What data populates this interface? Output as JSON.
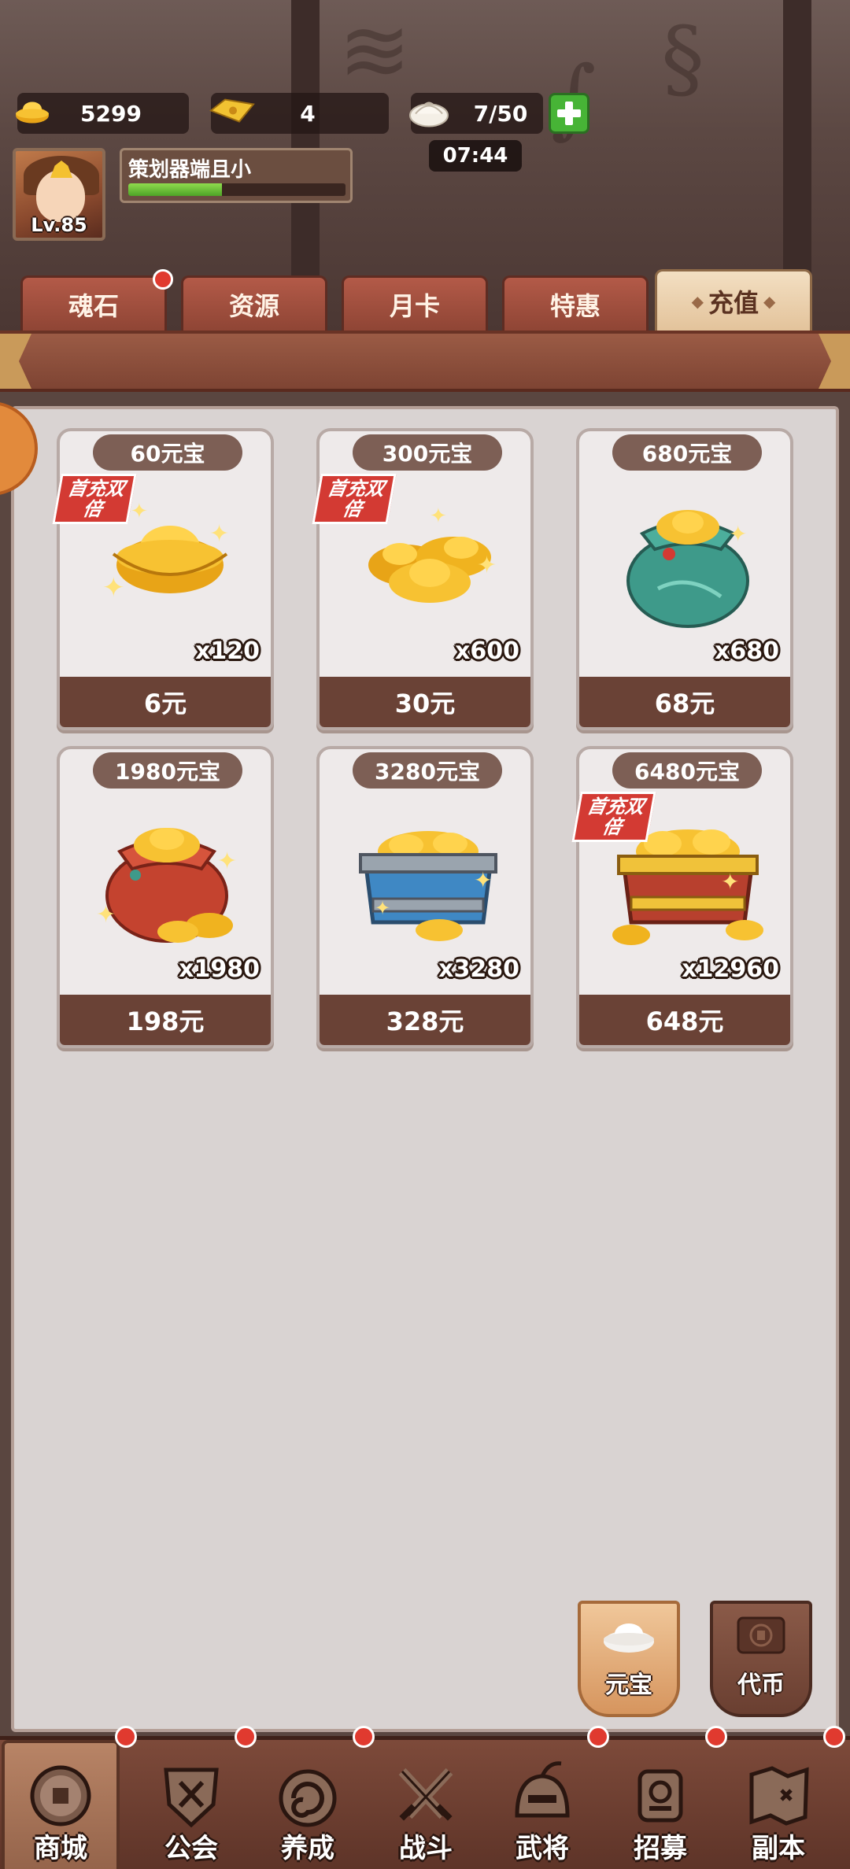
{
  "resources": {
    "gold": "5299",
    "tickets": "4",
    "stamina": "7/50",
    "timer": "07:44"
  },
  "player": {
    "name": "策划器端且小",
    "level": "Lv.85",
    "xp_fraction": 0.43
  },
  "tabs": [
    {
      "label": "魂石",
      "has_dot": true
    },
    {
      "label": "资源",
      "has_dot": false
    },
    {
      "label": "月卡",
      "has_dot": false
    },
    {
      "label": "特惠",
      "has_dot": false
    },
    {
      "label": "充值",
      "has_dot": false,
      "active": true
    }
  ],
  "badge_text": "首充双倍",
  "products": [
    {
      "label": "60元宝",
      "qty": "x120",
      "price": "6元",
      "first_double": true,
      "art": "gold-ingot"
    },
    {
      "label": "300元宝",
      "qty": "x600",
      "price": "30元",
      "first_double": true,
      "art": "gold-pile"
    },
    {
      "label": "680元宝",
      "qty": "x680",
      "price": "68元",
      "first_double": false,
      "art": "green-bag"
    },
    {
      "label": "1980元宝",
      "qty": "x1980",
      "price": "198元",
      "first_double": false,
      "art": "red-bag"
    },
    {
      "label": "3280元宝",
      "qty": "x3280",
      "price": "328元",
      "first_double": false,
      "art": "blue-chest"
    },
    {
      "label": "6480元宝",
      "qty": "x12960",
      "price": "648元",
      "first_double": true,
      "art": "gold-chest"
    }
  ],
  "currency_toggle": {
    "yuanbao": "元宝",
    "daibi": "代币"
  },
  "bottom_nav": [
    {
      "label": "商城",
      "icon": "coin-icon",
      "active": true,
      "dot": true
    },
    {
      "label": "公会",
      "icon": "guild-shield-icon",
      "active": false,
      "dot": true
    },
    {
      "label": "养成",
      "icon": "swirl-icon",
      "active": false,
      "dot": true
    },
    {
      "label": "战斗",
      "icon": "crossed-swords-icon",
      "active": false,
      "dot": false
    },
    {
      "label": "武将",
      "icon": "helmet-icon",
      "active": false,
      "dot": true
    },
    {
      "label": "招募",
      "icon": "scroll-token-icon",
      "active": false,
      "dot": true
    },
    {
      "label": "副本",
      "icon": "map-icon",
      "active": false,
      "dot": true
    }
  ],
  "colors": {
    "tab_red": "#a04d3d",
    "tab_active": "#ecd2b0",
    "price_bar": "#6a4236",
    "badge_red": "#d33a33",
    "notify_red": "#e03a2f",
    "xp_green": "#6cc23a"
  }
}
